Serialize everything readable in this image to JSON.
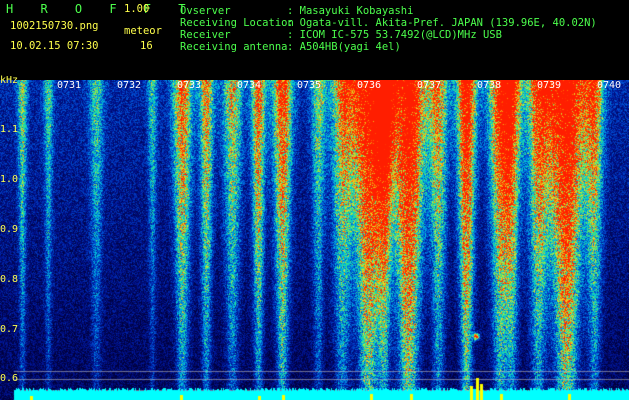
{
  "header": {
    "logo": "H R O F F T",
    "version": "1.00",
    "filename": "1002150730.png",
    "datetime": "10.02.15 07:30",
    "mode_label": "meteor",
    "meteor_count": "16",
    "fields": [
      {
        "label": "Ovserver",
        "value": ": Masayuki Kobayashi"
      },
      {
        "label": "Receiving Location",
        "value": ": Ogata-vill. Akita-Pref. JAPAN (139.96E, 40.02N)"
      },
      {
        "label": "Receiver",
        "value": ": ICOM IC-575 53.7492(@LCD)MHz USB"
      },
      {
        "label": "Receiving antenna",
        "value": ": A504HB(yagi 4el)"
      }
    ]
  },
  "axis": {
    "y_unit": "kHz",
    "y_ticks": [
      "1.1",
      "1.0",
      "0.9",
      "0.8",
      "0.7",
      "0.6"
    ],
    "x_ticks": [
      "0731",
      "0732",
      "0733",
      "0734",
      "0735",
      "0736",
      "0737",
      "0738",
      "0739",
      "0740"
    ]
  },
  "colors": {
    "background": "#000000",
    "header_green": "#4cff4c",
    "label_yellow": "#ffff4c",
    "spectrum_low": "#00007a",
    "spectrum_high": "#ff2000"
  }
}
